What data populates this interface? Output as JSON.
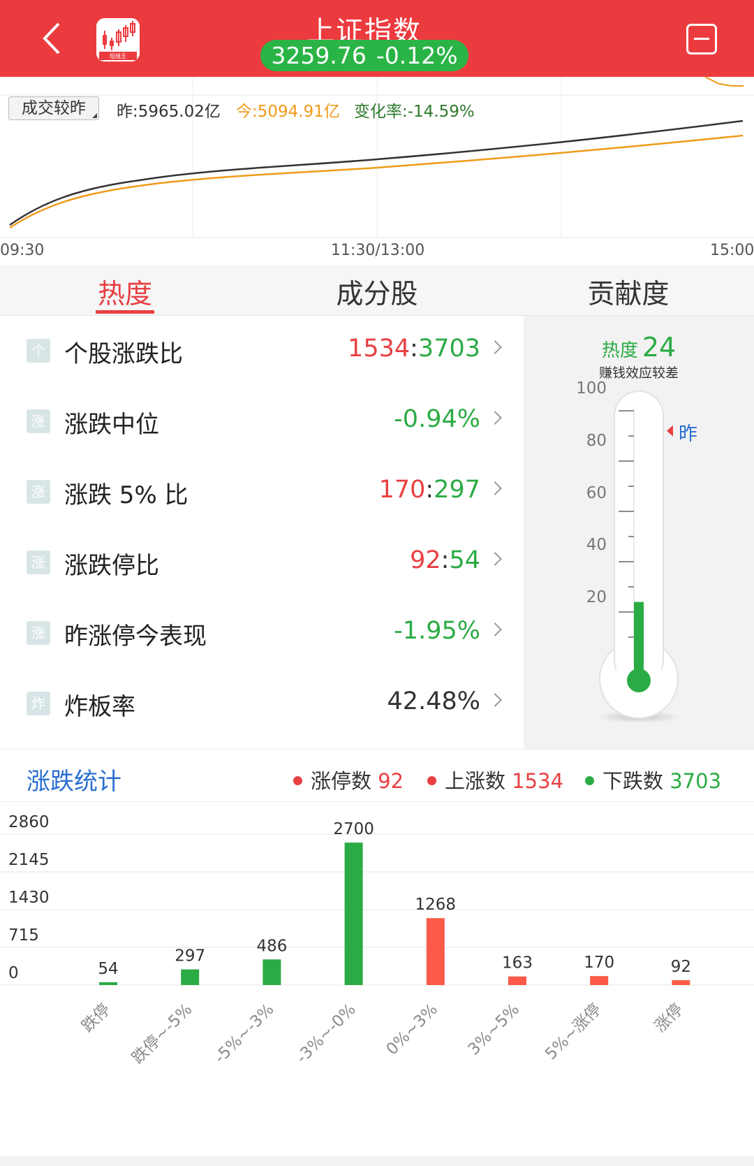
{
  "header": {
    "title": "上证指数",
    "price": "3259.76",
    "change": "-0.12%",
    "app_logo_label": "短线王",
    "colors": {
      "bar": "#ec3b3f",
      "pill": "#2bb446"
    }
  },
  "volume": {
    "selector": "成交较昨",
    "yesterday": "昨:5965.02亿",
    "today": "今:5094.91亿",
    "change_rate": "变化率:-14.59%",
    "time_labels": [
      "09:30",
      "11:30/13:00",
      "15:00"
    ]
  },
  "tabs": [
    "热度",
    "成分股",
    "贡献度"
  ],
  "metrics": [
    {
      "icon": "个",
      "label": "个股涨跌比",
      "up": "1534",
      "sep": ":",
      "down": "3703"
    },
    {
      "icon": "涨",
      "label": "涨跌中位",
      "value": "-0.94%",
      "color": "green"
    },
    {
      "icon": "涨",
      "label": "涨跌 5% 比",
      "up": "170",
      "sep": ":",
      "down": "297"
    },
    {
      "icon": "涨",
      "label": "涨跌停比",
      "up": "92",
      "sep": ":",
      "down": "54"
    },
    {
      "icon": "涨",
      "label": "昨涨停今表现",
      "value": "-1.95%",
      "color": "green"
    },
    {
      "icon": "炸",
      "label": "炸板率",
      "value": "42.48%",
      "color": "dark"
    }
  ],
  "heat": {
    "label": "热度",
    "value": "24",
    "level": 24,
    "yesterday_level": 92,
    "desc": "赚钱效应较差",
    "scale": [
      "100",
      "80",
      "60",
      "40",
      "20"
    ],
    "yesterday_label": "昨"
  },
  "stats": {
    "title": "涨跌统计",
    "legend": [
      {
        "name": "涨停数",
        "value": "92",
        "color": "#e84043"
      },
      {
        "name": "上涨数",
        "value": "1534",
        "color": "#e84043"
      },
      {
        "name": "下跌数",
        "value": "3703",
        "color": "#2bab44"
      }
    ]
  },
  "chart_data": {
    "type": "bar",
    "categories": [
      "跌停",
      "跌停~-5%",
      "-5%~-3%",
      "-3%~-0%",
      "0%~3%",
      "3%~5%",
      "5%~涨停",
      "涨停"
    ],
    "values": [
      54,
      297,
      486,
      2700,
      1268,
      163,
      170,
      92
    ],
    "colors": [
      "#2bab44",
      "#2bab44",
      "#2bab44",
      "#2bab44",
      "#fa5a47",
      "#fa5a47",
      "#fa5a47",
      "#fa5a47"
    ],
    "ylim": [
      0,
      2860
    ],
    "yticks": [
      "2860",
      "2145",
      "1430",
      "715",
      "0"
    ],
    "title": "涨跌统计",
    "xlabel": "",
    "ylabel": "",
    "grid": true
  }
}
